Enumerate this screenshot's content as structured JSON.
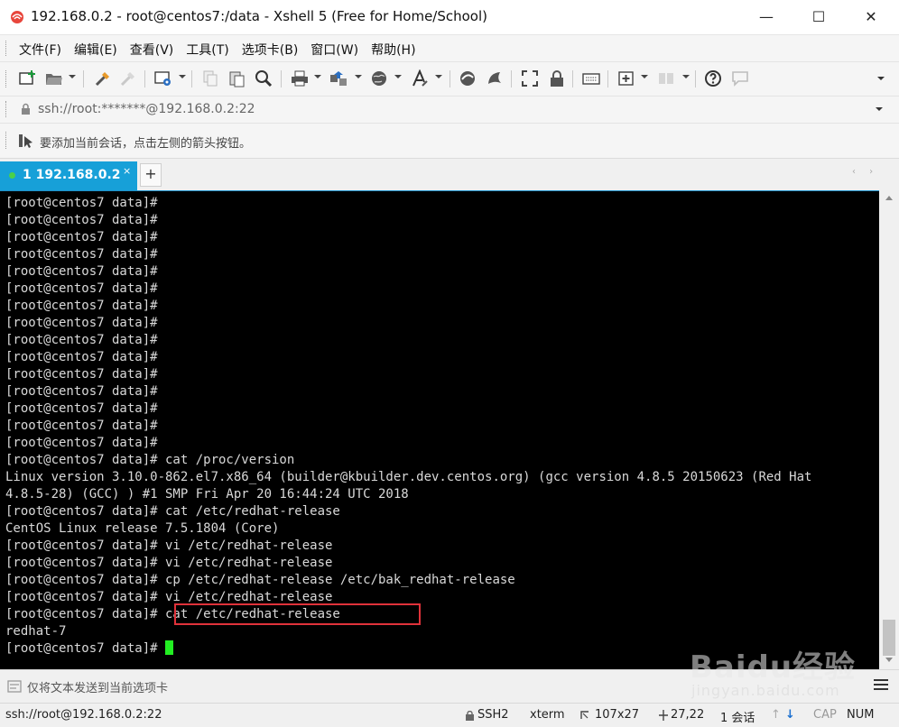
{
  "window": {
    "title": "192.168.0.2 - root@centos7:/data - Xshell 5 (Free for Home/School)",
    "controls": {
      "minimize": "—",
      "maximize": "☐",
      "close": "✕"
    }
  },
  "menu": [
    "文件(F)",
    "编辑(E)",
    "查看(V)",
    "工具(T)",
    "选项卡(B)",
    "窗口(W)",
    "帮助(H)"
  ],
  "address": {
    "value": "ssh://root:*******@192.168.0.2:22"
  },
  "hint": {
    "text": "要添加当前会话，点击左侧的箭头按钮。"
  },
  "tabs": [
    {
      "label": "1 192.168.0.2",
      "close": "×",
      "active": true
    }
  ],
  "newtab": "+",
  "tabnav": "‹ ›",
  "terminal": {
    "lines": [
      "[root@centos7 data]#",
      "[root@centos7 data]#",
      "[root@centos7 data]#",
      "[root@centos7 data]#",
      "[root@centos7 data]#",
      "[root@centos7 data]#",
      "[root@centos7 data]#",
      "[root@centos7 data]#",
      "[root@centos7 data]#",
      "[root@centos7 data]#",
      "[root@centos7 data]#",
      "[root@centos7 data]#",
      "[root@centos7 data]#",
      "[root@centos7 data]#",
      "[root@centos7 data]#",
      "[root@centos7 data]# cat /proc/version",
      "Linux version 3.10.0-862.el7.x86_64 (builder@kbuilder.dev.centos.org) (gcc version 4.8.5 20150623 (Red Hat",
      "4.8.5-28) (GCC) ) #1 SMP Fri Apr 20 16:44:24 UTC 2018",
      "[root@centos7 data]# cat /etc/redhat-release",
      "CentOS Linux release 7.5.1804 (Core)",
      "[root@centos7 data]# vi /etc/redhat-release",
      "[root@centos7 data]# vi /etc/redhat-release",
      "[root@centos7 data]# cp /etc/redhat-release /etc/bak_redhat-release",
      "[root@centos7 data]# vi /etc/redhat-release",
      "[root@centos7 data]# cat /etc/redhat-release",
      "redhat-7"
    ],
    "prompt": "[root@centos7 data]# ",
    "highlight_color": "#e0323a",
    "cursor_color": "#22ee22"
  },
  "compose": {
    "placeholder": "仅将文本发送到当前选项卡"
  },
  "status": {
    "connection": "ssh://root@192.168.0.2:22",
    "protocol": "SSH2",
    "terminal_type": "xterm",
    "size": "107x27",
    "cursor_pos": "27,22",
    "sessions": "1 会话",
    "caps": "CAP",
    "num": "NUM"
  },
  "watermark": {
    "brand": "Baidu经验",
    "sub": "jingyan.baidu.com"
  },
  "colors": {
    "accent": "#17a0d8",
    "terminal_bg": "#000000",
    "terminal_fg": "#d9d9d9"
  }
}
